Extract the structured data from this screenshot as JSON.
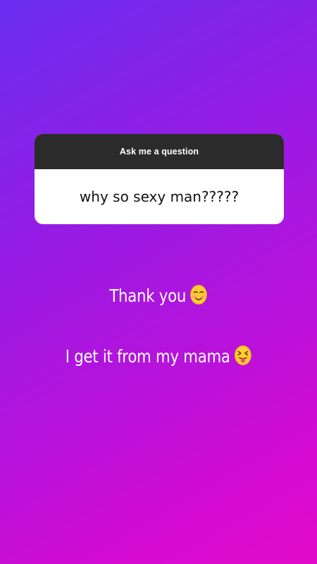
{
  "question_sticker": {
    "header": "Ask me a question",
    "question": "why so sexy man?????"
  },
  "reply": {
    "line1": "Thank you",
    "line1_emoji": "smiling-blush-emoji",
    "line2": "I get it from my mama",
    "line2_emoji": "squinting-tongue-emoji"
  },
  "colors": {
    "gradient_start": "#6a2ef0",
    "gradient_end": "#e10bc9",
    "card_header_bg": "#2b2b2b",
    "emoji_yellow": "#ffcc33"
  }
}
